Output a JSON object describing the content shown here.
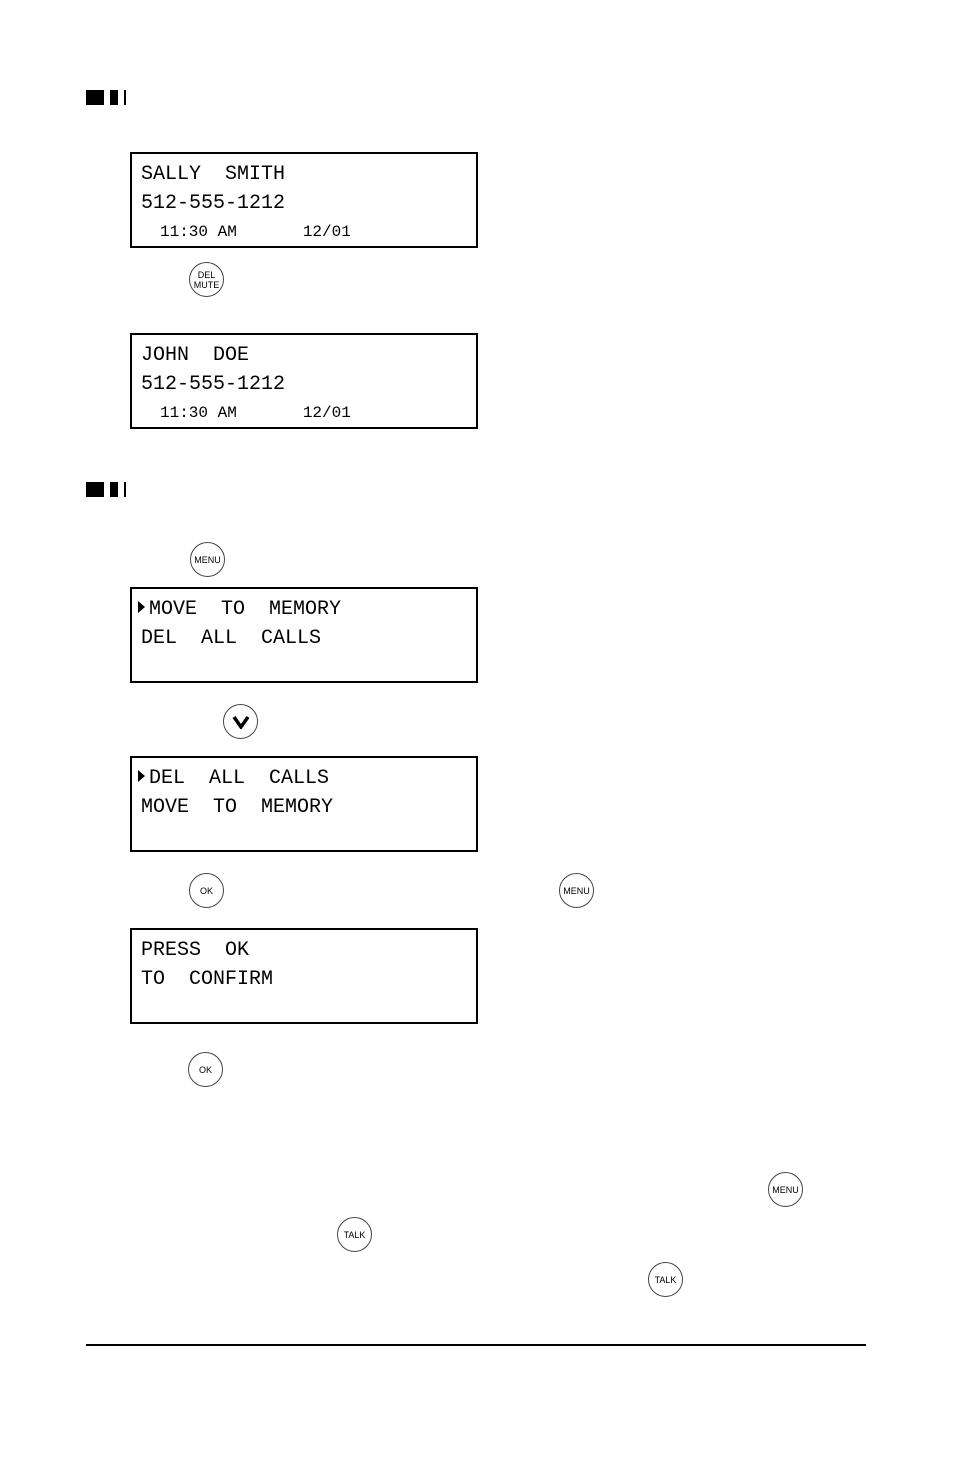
{
  "screens": [
    {
      "lines": [
        "SALLY  SMITH",
        "512-555-1212"
      ],
      "time": "11:30 AM",
      "date": "12/01"
    },
    {
      "lines": [
        "JOHN  DOE",
        "512-555-1212"
      ],
      "time": "11:30 AM",
      "date": "12/01"
    },
    {
      "selected": "MOVE  TO  MEMORY",
      "other": "DEL  ALL  CALLS"
    },
    {
      "selected": "DEL  ALL  CALLS",
      "other": "MOVE  TO  MEMORY"
    },
    {
      "lines": [
        "PRESS  OK",
        "TO  CONFIRM"
      ]
    }
  ],
  "buttons": {
    "del_mute": [
      "DEL",
      "MUTE"
    ],
    "menu": "MENU",
    "down": "down-arrow",
    "ok": "OK",
    "talk": "TALK"
  },
  "colors": {
    "ink": "#000000",
    "paper": "#ffffff"
  }
}
